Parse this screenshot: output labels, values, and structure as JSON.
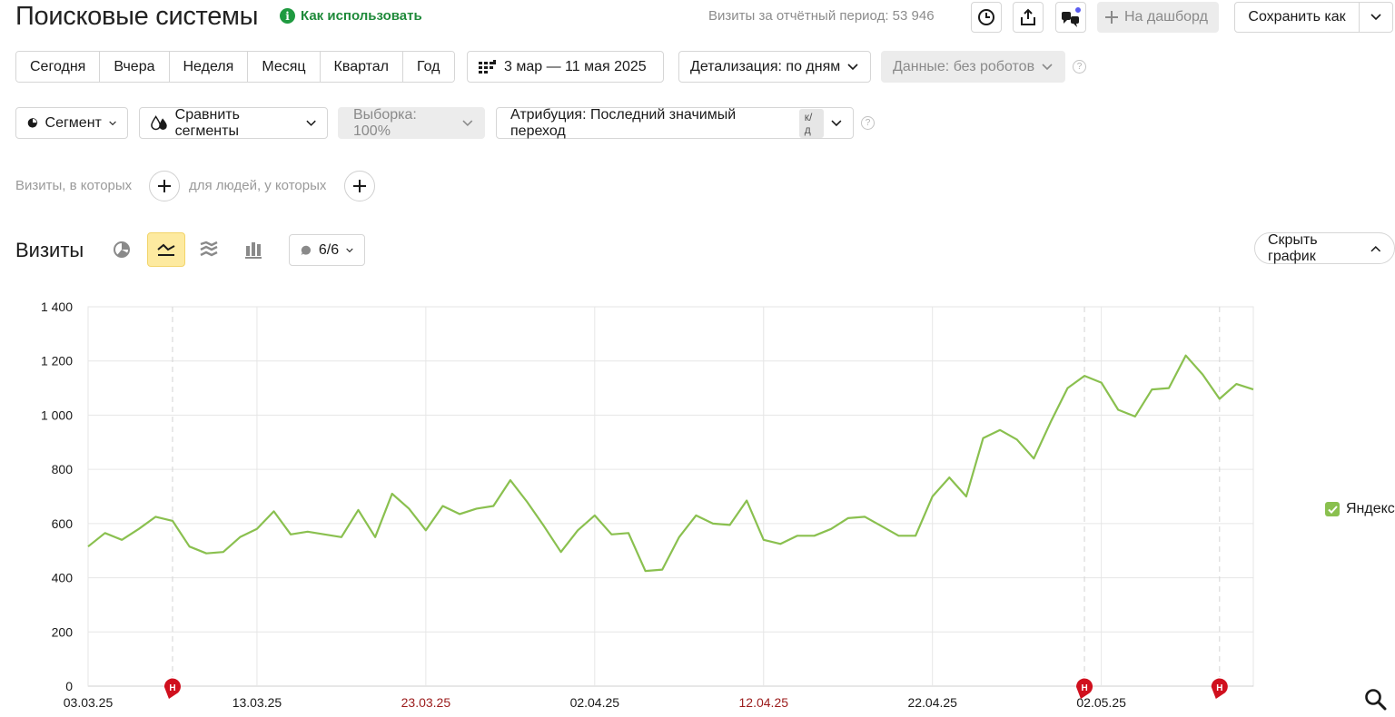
{
  "header": {
    "title": "Поисковые системы",
    "how_to_use": "Как использовать",
    "visits_total": "Визиты за отчётный период: 53 946",
    "to_dashboard": "На дашборд",
    "save_as": "Сохранить как"
  },
  "period": {
    "tabs": [
      "Сегодня",
      "Вчера",
      "Неделя",
      "Месяц",
      "Квартал",
      "Год"
    ],
    "date_range": "3 мар — 11 мая 2025",
    "detail": "Детализация: по дням",
    "robots": "Данные: без роботов"
  },
  "filters": {
    "segment": "Сегмент",
    "compare": "Сравнить сегменты",
    "sample": "Выборка: 100%",
    "attribution": "Атрибуция: Последний значимый переход",
    "attribution_badge": "к/д"
  },
  "segment_builder": {
    "visits_where": "Визиты, в которых",
    "people_where": "для людей, у которых"
  },
  "chart_header": {
    "title": "Визиты",
    "notes_count": "6/6",
    "hide_chart": "Скрыть график"
  },
  "colors": {
    "series": "#8ac04f",
    "holiday": "#9b1b1b",
    "marker": "#d0101e",
    "active_view": "#fdeaa0"
  },
  "chart_data": {
    "type": "line",
    "title": "",
    "xlabel": "",
    "ylabel": "",
    "ylim": [
      0,
      1400
    ],
    "yticks": [
      0,
      200,
      400,
      600,
      800,
      1000,
      1200,
      1400
    ],
    "ytick_labels": [
      "0",
      "200",
      "400",
      "600",
      "800",
      "1 000",
      "1 200",
      "1 400"
    ],
    "x_start": "2025-03-03",
    "x_end": "2025-05-11",
    "xticks": [
      {
        "date": "2025-03-03",
        "label": "03.03.25",
        "holiday": false
      },
      {
        "date": "2025-03-13",
        "label": "13.03.25",
        "holiday": false
      },
      {
        "date": "2025-03-23",
        "label": "23.03.25",
        "holiday": true
      },
      {
        "date": "2025-04-02",
        "label": "02.04.25",
        "holiday": false
      },
      {
        "date": "2025-04-12",
        "label": "12.04.25",
        "holiday": true
      },
      {
        "date": "2025-04-22",
        "label": "22.04.25",
        "holiday": false
      },
      {
        "date": "2025-05-02",
        "label": "02.05.25",
        "holiday": false
      }
    ],
    "note_markers": [
      {
        "date": "2025-03-08",
        "label": "Н"
      },
      {
        "date": "2025-05-01",
        "label": "Н"
      },
      {
        "date": "2025-05-09",
        "label": "Н"
      }
    ],
    "grid": true,
    "legend_position": "right",
    "series": [
      {
        "name": "Яндекс",
        "color": "#8ac04f",
        "x": [
          "2025-03-03",
          "2025-03-04",
          "2025-03-05",
          "2025-03-06",
          "2025-03-07",
          "2025-03-08",
          "2025-03-09",
          "2025-03-10",
          "2025-03-11",
          "2025-03-12",
          "2025-03-13",
          "2025-03-14",
          "2025-03-15",
          "2025-03-16",
          "2025-03-17",
          "2025-03-18",
          "2025-03-19",
          "2025-03-20",
          "2025-03-21",
          "2025-03-22",
          "2025-03-23",
          "2025-03-24",
          "2025-03-25",
          "2025-03-26",
          "2025-03-27",
          "2025-03-28",
          "2025-03-29",
          "2025-03-30",
          "2025-03-31",
          "2025-04-01",
          "2025-04-02",
          "2025-04-03",
          "2025-04-04",
          "2025-04-05",
          "2025-04-06",
          "2025-04-07",
          "2025-04-08",
          "2025-04-09",
          "2025-04-10",
          "2025-04-11",
          "2025-04-12",
          "2025-04-13",
          "2025-04-14",
          "2025-04-15",
          "2025-04-16",
          "2025-04-17",
          "2025-04-18",
          "2025-04-19",
          "2025-04-20",
          "2025-04-21",
          "2025-04-22",
          "2025-04-23",
          "2025-04-24",
          "2025-04-25",
          "2025-04-26",
          "2025-04-27",
          "2025-04-28",
          "2025-04-29",
          "2025-04-30",
          "2025-05-01",
          "2025-05-02",
          "2025-05-03",
          "2025-05-04",
          "2025-05-05",
          "2025-05-06",
          "2025-05-07",
          "2025-05-08",
          "2025-05-09",
          "2025-05-10",
          "2025-05-11"
        ],
        "values": [
          515,
          565,
          540,
          580,
          625,
          610,
          515,
          490,
          495,
          550,
          580,
          645,
          560,
          570,
          560,
          550,
          650,
          550,
          710,
          655,
          575,
          665,
          635,
          655,
          665,
          760,
          680,
          590,
          495,
          575,
          630,
          560,
          565,
          425,
          430,
          550,
          630,
          600,
          595,
          685,
          540,
          525,
          555,
          555,
          580,
          620,
          625,
          590,
          555,
          555,
          700,
          770,
          700,
          915,
          945,
          910,
          840,
          975,
          1100,
          1145,
          1120,
          1020,
          995,
          1095,
          1100,
          1220,
          1150,
          1060,
          1115,
          1095
        ]
      }
    ]
  }
}
